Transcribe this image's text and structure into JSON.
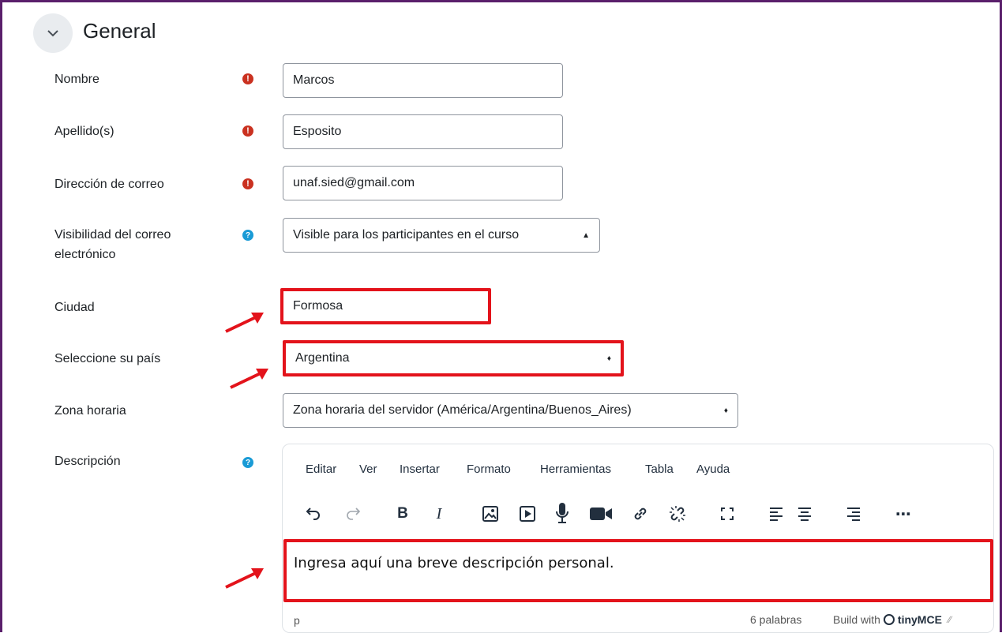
{
  "section": {
    "title": "General"
  },
  "fields": {
    "nombre": {
      "label": "Nombre",
      "value": "Marcos"
    },
    "apellido": {
      "label": "Apellido(s)",
      "value": "Esposito"
    },
    "correo": {
      "label": "Dirección de correo",
      "value": "unaf.sied@gmail.com"
    },
    "visibilidad": {
      "label_line1": "Visibilidad del correo",
      "label_line2": "electrónico",
      "value": "Visible para los participantes en el curso"
    },
    "ciudad": {
      "label": "Ciudad",
      "value": "Formosa"
    },
    "pais": {
      "label": "Seleccione su país",
      "value": "Argentina"
    },
    "zona": {
      "label": "Zona horaria",
      "value": "Zona horaria del servidor (América/Argentina/Buenos_Aires)"
    },
    "descripcion": {
      "label": "Descripción"
    }
  },
  "editor": {
    "menu": [
      "Editar",
      "Ver",
      "Insertar",
      "Formato",
      "Herramientas",
      "Tabla",
      "Ayuda"
    ],
    "content": "Ingresa aquí una breve descripción personal.",
    "status_path": "p",
    "word_count": "6 palabras",
    "branding": "Build with",
    "brand_name": "tinyMCE"
  },
  "icons": {
    "required": "exclamation-circle-icon",
    "help": "question-circle-icon"
  },
  "colors": {
    "highlight": "#e3131b",
    "required": "#ca3120",
    "help": "#1a9bd6",
    "frame": "#5a1f6b"
  }
}
